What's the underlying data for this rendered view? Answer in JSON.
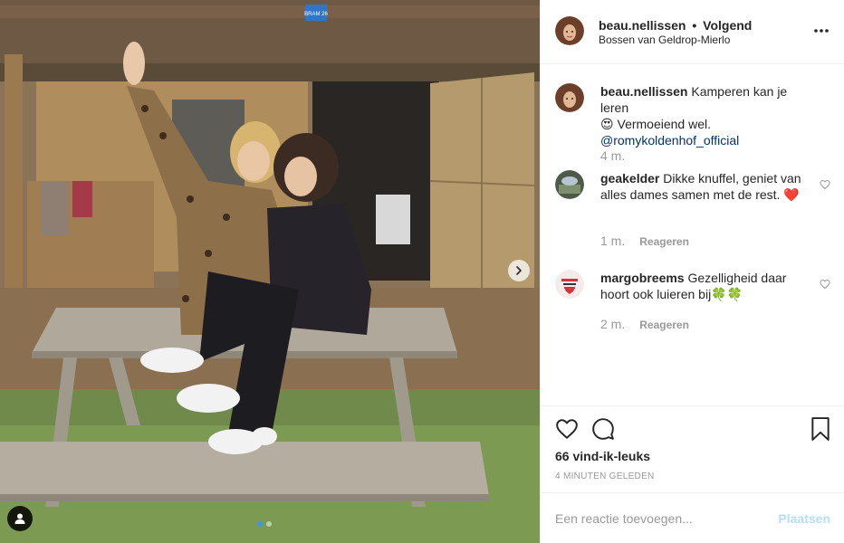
{
  "post": {
    "author": "beau.nellissen",
    "separator": "•",
    "follow_status": "Volgend",
    "location": "Bossen van Geldrop-Mierlo",
    "photo": {
      "sign_text": "BRAM 26",
      "image_count": 2,
      "active_index": 1
    }
  },
  "comments": [
    {
      "user": "beau.nellissen",
      "text_before": " Kamperen kan je leren ",
      "emoji": "😍",
      "text_after": " Vermoeiend wel.",
      "mention": "@romykoldenhof_official",
      "time": "4 m.",
      "reply_label": ""
    },
    {
      "user": "geakelder",
      "text": " Dikke knuffel, geniet van alles dames samen met de rest. ",
      "emoji": "❤️",
      "time": "1 m.",
      "reply_label": "Reageren"
    },
    {
      "user": "margobreems",
      "text": " Gezelligheid daar hoort ook luieren bij",
      "emoji": "🍀🍀",
      "time": "2 m.",
      "reply_label": "Reageren",
      "avatar_text": "IK HEB EEN SUPERLIEVE ZE HEEFT MIJ"
    }
  ],
  "actions": {
    "likes": "66 vind-ik-leuks",
    "time_ago": "4 MINUTEN GELEDEN"
  },
  "composer": {
    "placeholder": "Een reactie toevoegen...",
    "post_label": "Plaatsen"
  },
  "colors": {
    "text": "#262626",
    "muted": "#999999",
    "link": "#003569",
    "post_disabled": "#b2dffc",
    "dot_active": "#3897f0",
    "heart_red": "#ed4956"
  }
}
